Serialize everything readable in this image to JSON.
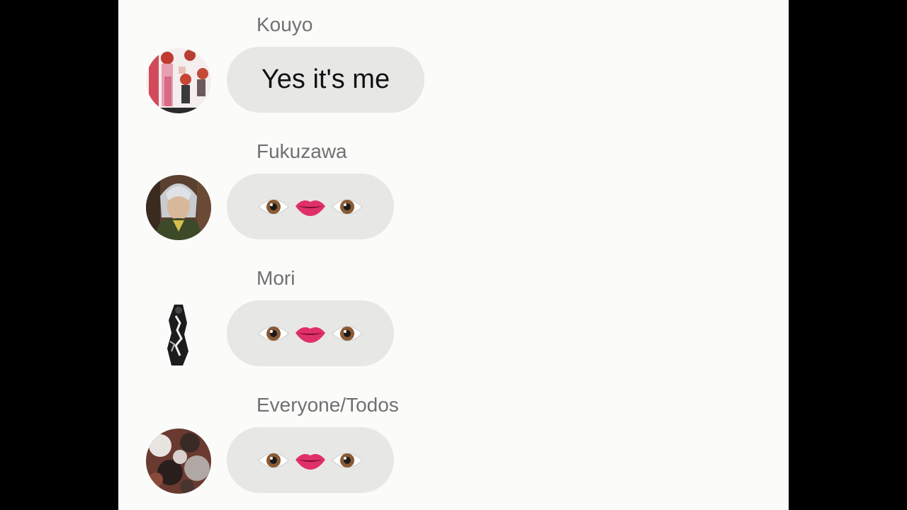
{
  "messages": [
    {
      "sender": "Kouyo",
      "text": "Yes it's me",
      "avatar_icon": "anime-collage-avatar",
      "kind": "text"
    },
    {
      "sender": "Fukuzawa",
      "emojis": [
        "eye-icon",
        "lips-icon",
        "eye-icon"
      ],
      "avatar_icon": "silver-haired-man-avatar",
      "kind": "emoji"
    },
    {
      "sender": "Mori",
      "emojis": [
        "eye-icon",
        "lips-icon",
        "eye-icon"
      ],
      "avatar_icon": "black-white-figure-avatar",
      "kind": "emoji"
    },
    {
      "sender": "Everyone/Todos",
      "emojis": [
        "eye-icon",
        "lips-icon",
        "eye-icon"
      ],
      "avatar_icon": "dark-collage-avatar",
      "kind": "emoji"
    }
  ],
  "colors": {
    "background": "#fbfcfa",
    "bubble": "#e7e8e6",
    "sender_text": "#707070",
    "letterbox": "#000000"
  }
}
